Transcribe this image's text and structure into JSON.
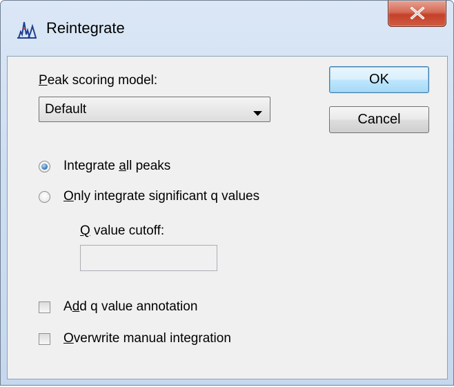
{
  "window": {
    "title": "Reintegrate",
    "close_glyph": "X"
  },
  "form": {
    "model_label_mnemonic": "P",
    "model_label_rest": "eak scoring model:",
    "model_value": "Default",
    "radio_all_pre": "Integrate ",
    "radio_all_mnemonic": "a",
    "radio_all_post": "ll peaks",
    "radio_all_checked": true,
    "radio_sig_mnemonic": "O",
    "radio_sig_rest": "nly integrate significant q values",
    "radio_sig_checked": false,
    "qvalue_label_mnemonic": "Q",
    "qvalue_label_rest": " value cutoff:",
    "qvalue_value": "",
    "check_annot_pre": "A",
    "check_annot_mnemonic": "d",
    "check_annot_post": "d q value annotation",
    "check_annot_checked": false,
    "check_overwrite_mnemonic": "O",
    "check_overwrite_rest": "verwrite manual integration",
    "check_overwrite_checked": false
  },
  "buttons": {
    "ok": "OK",
    "cancel": "Cancel"
  },
  "icons": {
    "app": "reintegrate-peak-icon",
    "close": "close-icon",
    "dropdown": "chevron-down-icon"
  },
  "colors": {
    "close_red": "#c4402a",
    "default_button_border": "#3c7fb1",
    "client_bg": "#f0f0f0"
  }
}
